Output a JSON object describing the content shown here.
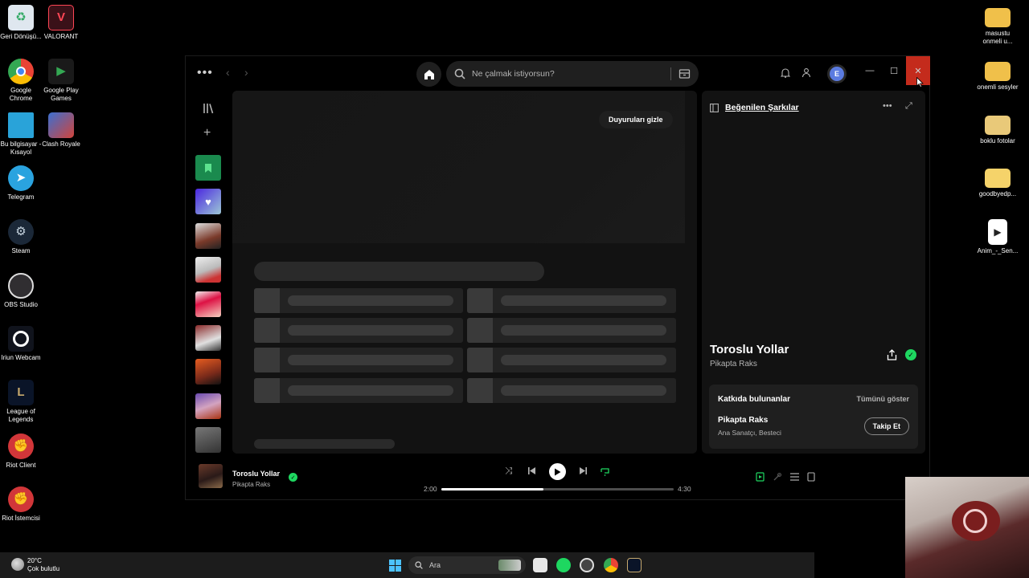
{
  "desktop": {
    "left_icons": [
      {
        "label": "Geri Dönüşü...",
        "icon": "recycle-bin-icon"
      },
      {
        "label": "VALORANT",
        "icon": "valorant-icon"
      },
      {
        "label": "Google Chrome",
        "icon": "chrome-icon"
      },
      {
        "label": "Google Play Games",
        "icon": "google-play-games-icon"
      },
      {
        "label": "Bu bilgisayar - Kısayol",
        "icon": "this-pc-icon"
      },
      {
        "label": "Clash Royale",
        "icon": "clash-royale-icon"
      },
      {
        "label": "Telegram",
        "icon": "telegram-icon"
      },
      {
        "label": "Steam",
        "icon": "steam-icon"
      },
      {
        "label": "OBS Studio",
        "icon": "obs-icon"
      },
      {
        "label": "Iriun Webcam",
        "icon": "iriun-icon"
      },
      {
        "label": "League of Legends",
        "icon": "league-icon"
      },
      {
        "label": "Riot Client",
        "icon": "riot-client-icon"
      },
      {
        "label": "Riot İstemcisi",
        "icon": "riot-client-icon"
      }
    ],
    "right_icons": [
      {
        "label": "masustu onmeli u...",
        "icon": "folder-icon"
      },
      {
        "label": "onemli sesyler",
        "icon": "folder-icon"
      },
      {
        "label": "boklu fotolar",
        "icon": "folder-icon"
      },
      {
        "label": "goodbyedp...",
        "icon": "folder-icon"
      },
      {
        "label": "Anim_-_Sen...",
        "icon": "video-file-icon"
      }
    ]
  },
  "spotify": {
    "search_placeholder": "Ne çalmak istiyorsun?",
    "avatar_letter": "E",
    "hide_announcements": "Duyuruları gizle",
    "right_panel": {
      "title": "Beğenilen Şarkılar",
      "song": "Toroslu Yollar",
      "artist": "Pikapta Raks",
      "credits_heading": "Katkıda bulunanlar",
      "show_all": "Tümünü göster",
      "credit_name": "Pikapta Raks",
      "credit_role": "Ana Sanatçı, Besteci",
      "follow": "Takip Et"
    },
    "now_playing": {
      "title": "Toroslu Yollar",
      "artist": "Pikapta Raks",
      "elapsed": "2:00",
      "duration": "4:30",
      "progress_percent": 44
    }
  },
  "taskbar": {
    "temperature": "20°C",
    "weather": "Çok bulutlu",
    "search_label": "Ara"
  },
  "colors": {
    "spotify_green": "#1ed760",
    "close_red": "#c42b1c"
  }
}
